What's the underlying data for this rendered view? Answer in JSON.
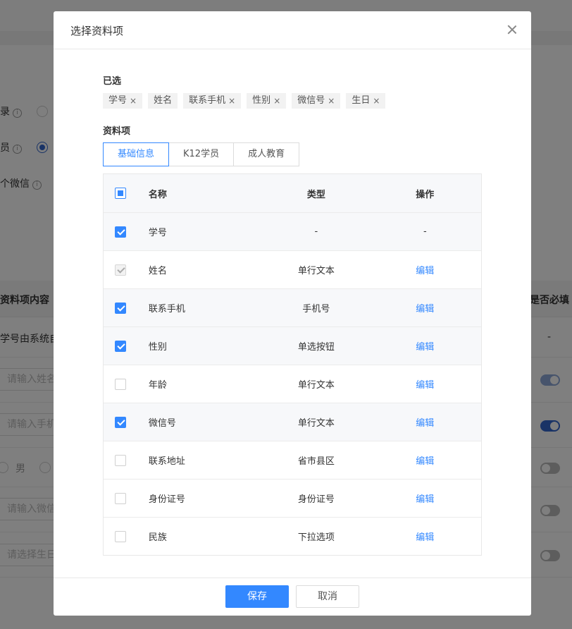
{
  "background": {
    "row1_label": "录",
    "row2_label": "员",
    "row3_label": "个微信",
    "info_glyph": "i",
    "col_content": "资料项内容",
    "col_required": "是否必填",
    "row_xuehao": "学号由系统自",
    "dash": "-",
    "ph_name": "请输入姓名",
    "ph_phone": "请输入手机",
    "radio_male": "男",
    "ph_wechat": "请输入微信",
    "ph_birthday": "请选择生日"
  },
  "dialog": {
    "title": "选择资料项",
    "selected_label": "已选",
    "tags": [
      {
        "label": "学号",
        "close": "×"
      },
      {
        "label": "姓名"
      },
      {
        "label": "联系手机",
        "close": "×"
      },
      {
        "label": "性别",
        "close": "×"
      },
      {
        "label": "微信号",
        "close": "×"
      },
      {
        "label": "生日",
        "close": "×"
      }
    ],
    "items_label": "资料项",
    "tabs": [
      {
        "label": "基础信息",
        "active": true
      },
      {
        "label": "K12学员"
      },
      {
        "label": "成人教育"
      }
    ],
    "table": {
      "headers": {
        "name": "名称",
        "type": "类型",
        "op": "操作"
      },
      "rows": [
        {
          "name": "学号",
          "type": "-",
          "op": "-",
          "checked": true
        },
        {
          "name": "姓名",
          "type": "单行文本",
          "op": "编辑",
          "checked": true,
          "disabled": true
        },
        {
          "name": "联系手机",
          "type": "手机号",
          "op": "编辑",
          "checked": true
        },
        {
          "name": "性别",
          "type": "单选按钮",
          "op": "编辑",
          "checked": true
        },
        {
          "name": "年龄",
          "type": "单行文本",
          "op": "编辑",
          "checked": false
        },
        {
          "name": "微信号",
          "type": "单行文本",
          "op": "编辑",
          "checked": true
        },
        {
          "name": "联系地址",
          "type": "省市县区",
          "op": "编辑",
          "checked": false
        },
        {
          "name": "身份证号",
          "type": "身份证号",
          "op": "编辑",
          "checked": false
        },
        {
          "name": "民族",
          "type": "下拉选项",
          "op": "编辑",
          "checked": false
        }
      ]
    },
    "save_label": "保存",
    "cancel_label": "取消"
  },
  "colors": {
    "accent": "#3388ff",
    "toggle_on": "#3366cc"
  }
}
